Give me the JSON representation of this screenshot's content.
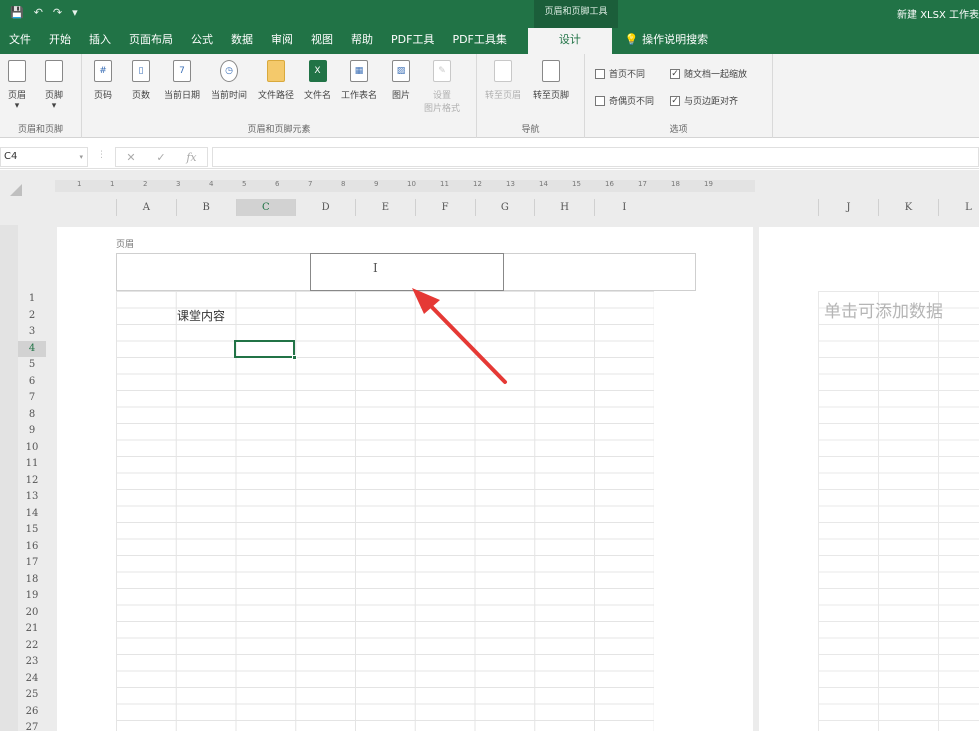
{
  "titlebar": {
    "qat": [
      "💾",
      "↶",
      "↷",
      "▾"
    ],
    "context_tab": "页眉和页脚工具",
    "window_title": "新建 XLSX 工作表"
  },
  "tabs": [
    {
      "label": "文件"
    },
    {
      "label": "开始"
    },
    {
      "label": "插入"
    },
    {
      "label": "页面布局"
    },
    {
      "label": "公式"
    },
    {
      "label": "数据"
    },
    {
      "label": "审阅"
    },
    {
      "label": "视图"
    },
    {
      "label": "帮助"
    },
    {
      "label": "PDF工具"
    },
    {
      "label": "PDF工具集"
    }
  ],
  "active_tab": "设计",
  "search_tab": "操作说明搜索",
  "ribbon": {
    "g1": {
      "label": "页眉和页脚",
      "header": "页眉",
      "footer": "页脚"
    },
    "g2": {
      "label": "页眉和页脚元素",
      "page_number": "页码",
      "page_count": "页数",
      "current_date": "当前日期",
      "current_time": "当前时间",
      "file_path": "文件路径",
      "file_name": "文件名",
      "sheet_name": "工作表名",
      "picture": "图片",
      "format_picture_1": "设置",
      "format_picture_2": "图片格式"
    },
    "g3": {
      "label": "导航",
      "goto_header": "转至页眉",
      "goto_footer": "转至页脚"
    },
    "g4": {
      "label": "选项",
      "diff_first": "首页不同",
      "diff_odd_even": "奇偶页不同",
      "scale_with_doc": "随文档一起缩放",
      "align_margins": "与页边距对齐"
    }
  },
  "formula_bar": {
    "name_box": "C4",
    "cancel": "✕",
    "enter": "✓",
    "fx": "fx",
    "formula": ""
  },
  "columns": [
    "A",
    "B",
    "C",
    "D",
    "E",
    "F",
    "G",
    "H",
    "I"
  ],
  "columns2": [
    "J",
    "K",
    "L"
  ],
  "rows": [
    "1",
    "2",
    "3",
    "4",
    "5",
    "6",
    "7",
    "8",
    "9",
    "10",
    "11",
    "12",
    "13",
    "14",
    "15",
    "16",
    "17",
    "18",
    "19",
    "20",
    "21",
    "22",
    "23",
    "24",
    "25",
    "26",
    "27"
  ],
  "selected_cell": "C4",
  "header_label": "页眉",
  "cell_b2": "课堂内容",
  "add_data_hint": "单击可添加数据",
  "ruler_ticks": [
    "1",
    "1",
    "2",
    "3",
    "4",
    "5",
    "6",
    "7",
    "8",
    "9",
    "10",
    "11",
    "12",
    "13",
    "14",
    "15",
    "16",
    "17",
    "18",
    "19"
  ],
  "colors": {
    "accent": "#217346",
    "annotation_arrow": "#e53935"
  }
}
